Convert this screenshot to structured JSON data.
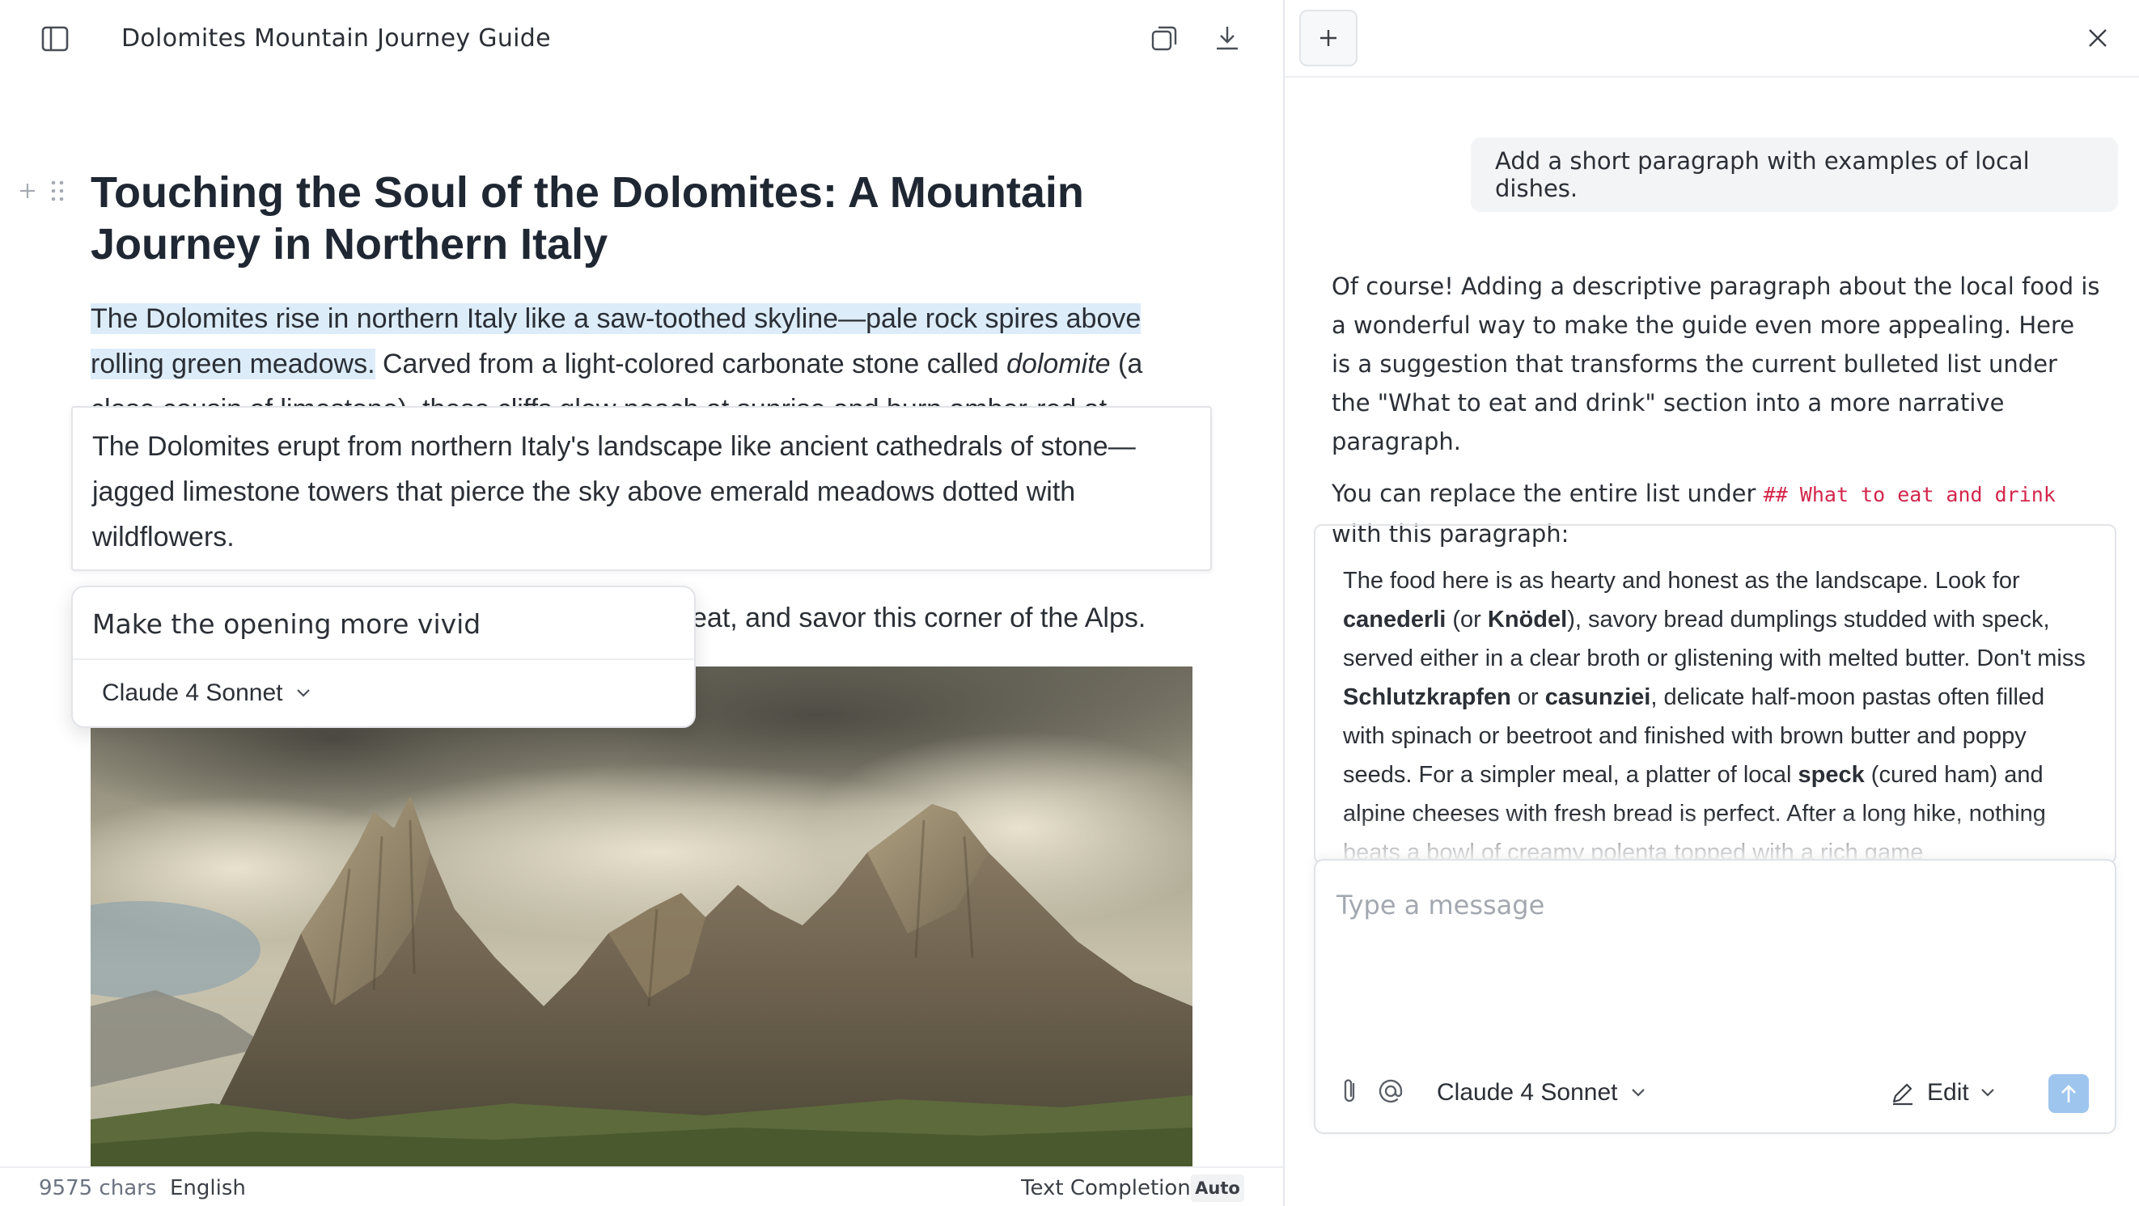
{
  "editor": {
    "doc_name": "Dolomites Mountain Journey Guide",
    "title": "Touching the Soul of the Dolomites: A Mountain Journey in Northern Italy",
    "paragraph": {
      "highlighted": "The Dolomites rise in northern Italy like a saw-toothed skyline—pale rock spires above rolling green meadows.",
      "rest_before_italic": " Carved from a light-colored carbonate stone called ",
      "italic": "dolomite",
      "rest_after_italic": " (a",
      "cut_line": "close cousin of limestone), these cliffs glow peach at sunrise and burn amber-red at"
    },
    "suggestion": "The Dolomites erupt from northern Italy's landscape like ancient cathedrals of stone—jagged limestone towers that pierce the sky above emerald meadows dotted with wildflowers.",
    "paragraph2_tail": "eat, and savor this corner of the Alps.",
    "prompt_popover": {
      "text": "Make the opening more vivid",
      "model": "Claude 4 Sonnet"
    },
    "status": {
      "chars": "9575 chars",
      "language": "English",
      "mode": "Text Completion",
      "auto": "Auto"
    }
  },
  "chat": {
    "user_message": "Add a short paragraph with examples of local dishes.",
    "assistant": {
      "p1": "Of course! Adding a descriptive paragraph about the local food is a wonderful way to make the guide even more appealing. Here is a suggestion that transforms the current bulleted list under the \"What to eat and drink\" section into a more narrative paragraph.",
      "p2_before": "You can replace the entire list under ",
      "p2_code": "## What to eat and drink",
      "p2_after": " with this paragraph:"
    },
    "quote": {
      "t1": "The food here is as hearty and honest as the landscape. Look for ",
      "b1": "canederli",
      "t2": " (or ",
      "b2": "Knödel",
      "t3": "), savory bread dumplings studded with speck, served either in a clear broth or glistening with melted butter. Don't miss ",
      "b3": "Schlutzkrapfen",
      "t4": " or ",
      "b4": "casunziei",
      "t5": ", delicate half-moon pastas often filled with spinach or beetroot and finished with brown butter and poppy seeds. For a simpler meal, a platter of local ",
      "b5": "speck",
      "t6": " (cured ham) and alpine cheeses with fresh bread is perfect. After a long hike, nothing beats a bowl of creamy polenta topped with a rich game"
    },
    "composer": {
      "placeholder": "Type a message",
      "model": "Claude 4 Sonnet",
      "edit_label": "Edit"
    }
  }
}
